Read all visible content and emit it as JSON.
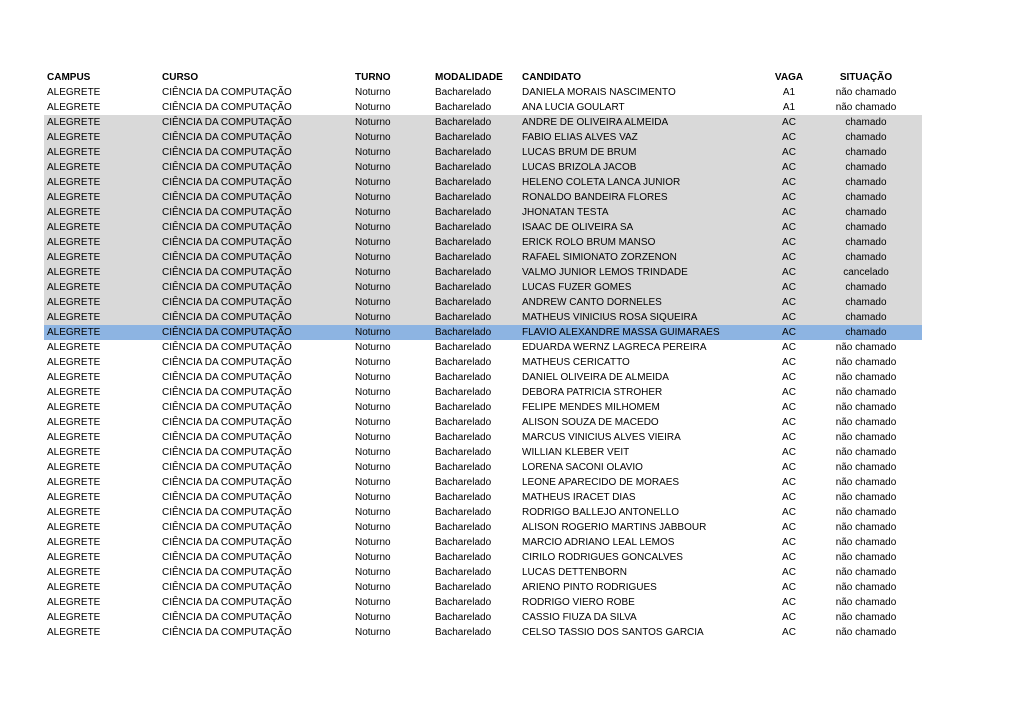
{
  "headers": {
    "campus": "CAMPUS",
    "curso": "CURSO",
    "turno": "TURNO",
    "modalidade": "MODALIDADE",
    "candidato": "CANDIDATO",
    "vaga": "VAGA",
    "situacao": "SITUAÇÃO"
  },
  "colors": {
    "called_band": "#d9d9d9",
    "selected_row": "#8db4e2"
  },
  "rows": [
    {
      "campus": "ALEGRETE",
      "curso": "CIÊNCIA DA COMPUTAÇÃO",
      "turno": "Noturno",
      "modalidade": "Bacharelado",
      "candidato": "DANIELA MORAIS NASCIMENTO",
      "vaga": "A1",
      "situacao": "não chamado",
      "highlight": "none"
    },
    {
      "campus": "ALEGRETE",
      "curso": "CIÊNCIA DA COMPUTAÇÃO",
      "turno": "Noturno",
      "modalidade": "Bacharelado",
      "candidato": "ANA LUCIA GOULART",
      "vaga": "A1",
      "situacao": "não chamado",
      "highlight": "none"
    },
    {
      "campus": "ALEGRETE",
      "curso": "CIÊNCIA DA COMPUTAÇÃO",
      "turno": "Noturno",
      "modalidade": "Bacharelado",
      "candidato": "ANDRE DE OLIVEIRA ALMEIDA",
      "vaga": "AC",
      "situacao": "chamado",
      "highlight": "gray"
    },
    {
      "campus": "ALEGRETE",
      "curso": "CIÊNCIA DA COMPUTAÇÃO",
      "turno": "Noturno",
      "modalidade": "Bacharelado",
      "candidato": "FABIO ELIAS ALVES VAZ",
      "vaga": "AC",
      "situacao": "chamado",
      "highlight": "gray"
    },
    {
      "campus": "ALEGRETE",
      "curso": "CIÊNCIA DA COMPUTAÇÃO",
      "turno": "Noturno",
      "modalidade": "Bacharelado",
      "candidato": "LUCAS BRUM DE BRUM",
      "vaga": "AC",
      "situacao": "chamado",
      "highlight": "gray"
    },
    {
      "campus": "ALEGRETE",
      "curso": "CIÊNCIA DA COMPUTAÇÃO",
      "turno": "Noturno",
      "modalidade": "Bacharelado",
      "candidato": "LUCAS BRIZOLA JACOB",
      "vaga": "AC",
      "situacao": "chamado",
      "highlight": "gray"
    },
    {
      "campus": "ALEGRETE",
      "curso": "CIÊNCIA DA COMPUTAÇÃO",
      "turno": "Noturno",
      "modalidade": "Bacharelado",
      "candidato": "HELENO COLETA LANCA JUNIOR",
      "vaga": "AC",
      "situacao": "chamado",
      "highlight": "gray"
    },
    {
      "campus": "ALEGRETE",
      "curso": "CIÊNCIA DA COMPUTAÇÃO",
      "turno": "Noturno",
      "modalidade": "Bacharelado",
      "candidato": "RONALDO BANDEIRA FLORES",
      "vaga": "AC",
      "situacao": "chamado",
      "highlight": "gray"
    },
    {
      "campus": "ALEGRETE",
      "curso": "CIÊNCIA DA COMPUTAÇÃO",
      "turno": "Noturno",
      "modalidade": "Bacharelado",
      "candidato": "JHONATAN TESTA",
      "vaga": "AC",
      "situacao": "chamado",
      "highlight": "gray"
    },
    {
      "campus": "ALEGRETE",
      "curso": "CIÊNCIA DA COMPUTAÇÃO",
      "turno": "Noturno",
      "modalidade": "Bacharelado",
      "candidato": "ISAAC DE OLIVEIRA SA",
      "vaga": "AC",
      "situacao": "chamado",
      "highlight": "gray"
    },
    {
      "campus": "ALEGRETE",
      "curso": "CIÊNCIA DA COMPUTAÇÃO",
      "turno": "Noturno",
      "modalidade": "Bacharelado",
      "candidato": "ERICK ROLO BRUM MANSO",
      "vaga": "AC",
      "situacao": "chamado",
      "highlight": "gray"
    },
    {
      "campus": "ALEGRETE",
      "curso": "CIÊNCIA DA COMPUTAÇÃO",
      "turno": "Noturno",
      "modalidade": "Bacharelado",
      "candidato": "RAFAEL SIMIONATO ZORZENON",
      "vaga": "AC",
      "situacao": "chamado",
      "highlight": "gray"
    },
    {
      "campus": "ALEGRETE",
      "curso": "CIÊNCIA DA COMPUTAÇÃO",
      "turno": "Noturno",
      "modalidade": "Bacharelado",
      "candidato": "VALMO JUNIOR LEMOS TRINDADE",
      "vaga": "AC",
      "situacao": "cancelado",
      "highlight": "gray"
    },
    {
      "campus": "ALEGRETE",
      "curso": "CIÊNCIA DA COMPUTAÇÃO",
      "turno": "Noturno",
      "modalidade": "Bacharelado",
      "candidato": "LUCAS FUZER GOMES",
      "vaga": "AC",
      "situacao": "chamado",
      "highlight": "gray"
    },
    {
      "campus": "ALEGRETE",
      "curso": "CIÊNCIA DA COMPUTAÇÃO",
      "turno": "Noturno",
      "modalidade": "Bacharelado",
      "candidato": "ANDREW CANTO DORNELES",
      "vaga": "AC",
      "situacao": "chamado",
      "highlight": "gray"
    },
    {
      "campus": "ALEGRETE",
      "curso": "CIÊNCIA DA COMPUTAÇÃO",
      "turno": "Noturno",
      "modalidade": "Bacharelado",
      "candidato": "MATHEUS VINICIUS ROSA SIQUEIRA",
      "vaga": "AC",
      "situacao": "chamado",
      "highlight": "gray"
    },
    {
      "campus": "ALEGRETE",
      "curso": "CIÊNCIA DA COMPUTAÇÃO",
      "turno": "Noturno",
      "modalidade": "Bacharelado",
      "candidato": "FLAVIO ALEXANDRE MASSA GUIMARAES",
      "vaga": "AC",
      "situacao": "chamado",
      "highlight": "blue"
    },
    {
      "campus": "ALEGRETE",
      "curso": "CIÊNCIA DA COMPUTAÇÃO",
      "turno": "Noturno",
      "modalidade": "Bacharelado",
      "candidato": "EDUARDA WERNZ LAGRECA PEREIRA",
      "vaga": "AC",
      "situacao": "não chamado",
      "highlight": "none"
    },
    {
      "campus": "ALEGRETE",
      "curso": "CIÊNCIA DA COMPUTAÇÃO",
      "turno": "Noturno",
      "modalidade": "Bacharelado",
      "candidato": "MATHEUS CERICATTO",
      "vaga": "AC",
      "situacao": "não chamado",
      "highlight": "none"
    },
    {
      "campus": "ALEGRETE",
      "curso": "CIÊNCIA DA COMPUTAÇÃO",
      "turno": "Noturno",
      "modalidade": "Bacharelado",
      "candidato": "DANIEL OLIVEIRA DE ALMEIDA",
      "vaga": "AC",
      "situacao": "não chamado",
      "highlight": "none"
    },
    {
      "campus": "ALEGRETE",
      "curso": "CIÊNCIA DA COMPUTAÇÃO",
      "turno": "Noturno",
      "modalidade": "Bacharelado",
      "candidato": "DEBORA PATRICIA STROHER",
      "vaga": "AC",
      "situacao": "não chamado",
      "highlight": "none"
    },
    {
      "campus": "ALEGRETE",
      "curso": "CIÊNCIA DA COMPUTAÇÃO",
      "turno": "Noturno",
      "modalidade": "Bacharelado",
      "candidato": "FELIPE MENDES MILHOMEM",
      "vaga": "AC",
      "situacao": "não chamado",
      "highlight": "none"
    },
    {
      "campus": "ALEGRETE",
      "curso": "CIÊNCIA DA COMPUTAÇÃO",
      "turno": "Noturno",
      "modalidade": "Bacharelado",
      "candidato": "ALISON SOUZA DE MACEDO",
      "vaga": "AC",
      "situacao": "não chamado",
      "highlight": "none"
    },
    {
      "campus": "ALEGRETE",
      "curso": "CIÊNCIA DA COMPUTAÇÃO",
      "turno": "Noturno",
      "modalidade": "Bacharelado",
      "candidato": "MARCUS VINICIUS ALVES VIEIRA",
      "vaga": "AC",
      "situacao": "não chamado",
      "highlight": "none"
    },
    {
      "campus": "ALEGRETE",
      "curso": "CIÊNCIA DA COMPUTAÇÃO",
      "turno": "Noturno",
      "modalidade": "Bacharelado",
      "candidato": "WILLIAN KLEBER VEIT",
      "vaga": "AC",
      "situacao": "não chamado",
      "highlight": "none"
    },
    {
      "campus": "ALEGRETE",
      "curso": "CIÊNCIA DA COMPUTAÇÃO",
      "turno": "Noturno",
      "modalidade": "Bacharelado",
      "candidato": "LORENA SACONI OLAVIO",
      "vaga": "AC",
      "situacao": "não chamado",
      "highlight": "none"
    },
    {
      "campus": "ALEGRETE",
      "curso": "CIÊNCIA DA COMPUTAÇÃO",
      "turno": "Noturno",
      "modalidade": "Bacharelado",
      "candidato": "LEONE APARECIDO DE MORAES",
      "vaga": "AC",
      "situacao": "não chamado",
      "highlight": "none"
    },
    {
      "campus": "ALEGRETE",
      "curso": "CIÊNCIA DA COMPUTAÇÃO",
      "turno": "Noturno",
      "modalidade": "Bacharelado",
      "candidato": "MATHEUS IRACET DIAS",
      "vaga": "AC",
      "situacao": "não chamado",
      "highlight": "none"
    },
    {
      "campus": "ALEGRETE",
      "curso": "CIÊNCIA DA COMPUTAÇÃO",
      "turno": "Noturno",
      "modalidade": "Bacharelado",
      "candidato": "RODRIGO BALLEJO ANTONELLO",
      "vaga": "AC",
      "situacao": "não chamado",
      "highlight": "none"
    },
    {
      "campus": "ALEGRETE",
      "curso": "CIÊNCIA DA COMPUTAÇÃO",
      "turno": "Noturno",
      "modalidade": "Bacharelado",
      "candidato": "ALISON ROGERIO MARTINS JABBOUR",
      "vaga": "AC",
      "situacao": "não chamado",
      "highlight": "none"
    },
    {
      "campus": "ALEGRETE",
      "curso": "CIÊNCIA DA COMPUTAÇÃO",
      "turno": "Noturno",
      "modalidade": "Bacharelado",
      "candidato": "MARCIO ADRIANO LEAL LEMOS",
      "vaga": "AC",
      "situacao": "não chamado",
      "highlight": "none"
    },
    {
      "campus": "ALEGRETE",
      "curso": "CIÊNCIA DA COMPUTAÇÃO",
      "turno": "Noturno",
      "modalidade": "Bacharelado",
      "candidato": "CIRILO RODRIGUES GONCALVES",
      "vaga": "AC",
      "situacao": "não chamado",
      "highlight": "none"
    },
    {
      "campus": "ALEGRETE",
      "curso": "CIÊNCIA DA COMPUTAÇÃO",
      "turno": "Noturno",
      "modalidade": "Bacharelado",
      "candidato": "LUCAS DETTENBORN",
      "vaga": "AC",
      "situacao": "não chamado",
      "highlight": "none"
    },
    {
      "campus": "ALEGRETE",
      "curso": "CIÊNCIA DA COMPUTAÇÃO",
      "turno": "Noturno",
      "modalidade": "Bacharelado",
      "candidato": "ARIENO PINTO RODRIGUES",
      "vaga": "AC",
      "situacao": "não chamado",
      "highlight": "none"
    },
    {
      "campus": "ALEGRETE",
      "curso": "CIÊNCIA DA COMPUTAÇÃO",
      "turno": "Noturno",
      "modalidade": "Bacharelado",
      "candidato": "RODRIGO VIERO ROBE",
      "vaga": "AC",
      "situacao": "não chamado",
      "highlight": "none"
    },
    {
      "campus": "ALEGRETE",
      "curso": "CIÊNCIA DA COMPUTAÇÃO",
      "turno": "Noturno",
      "modalidade": "Bacharelado",
      "candidato": "CASSIO FIUZA DA SILVA",
      "vaga": "AC",
      "situacao": "não chamado",
      "highlight": "none"
    },
    {
      "campus": "ALEGRETE",
      "curso": "CIÊNCIA DA COMPUTAÇÃO",
      "turno": "Noturno",
      "modalidade": "Bacharelado",
      "candidato": "CELSO TASSIO DOS SANTOS GARCIA",
      "vaga": "AC",
      "situacao": "não chamado",
      "highlight": "none"
    }
  ]
}
